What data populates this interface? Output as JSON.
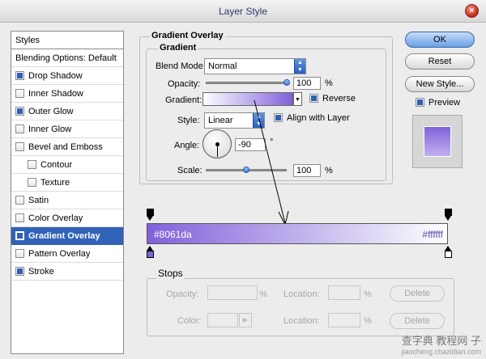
{
  "window": {
    "title": "Layer Style"
  },
  "styles_list": {
    "header": "Styles",
    "blending": "Blending Options: Default",
    "items": [
      {
        "label": "Drop Shadow",
        "checked": true,
        "indent": false,
        "selected": false
      },
      {
        "label": "Inner Shadow",
        "checked": false,
        "indent": false,
        "selected": false
      },
      {
        "label": "Outer Glow",
        "checked": true,
        "indent": false,
        "selected": false
      },
      {
        "label": "Inner Glow",
        "checked": false,
        "indent": false,
        "selected": false
      },
      {
        "label": "Bevel and Emboss",
        "checked": false,
        "indent": false,
        "selected": false
      },
      {
        "label": "Contour",
        "checked": false,
        "indent": true,
        "selected": false
      },
      {
        "label": "Texture",
        "checked": false,
        "indent": true,
        "selected": false
      },
      {
        "label": "Satin",
        "checked": false,
        "indent": false,
        "selected": false
      },
      {
        "label": "Color Overlay",
        "checked": false,
        "indent": false,
        "selected": false
      },
      {
        "label": "Gradient Overlay",
        "checked": true,
        "indent": false,
        "selected": true
      },
      {
        "label": "Pattern Overlay",
        "checked": false,
        "indent": false,
        "selected": false
      },
      {
        "label": "Stroke",
        "checked": true,
        "indent": false,
        "selected": false
      }
    ]
  },
  "gradient_overlay": {
    "section_title": "Gradient Overlay",
    "group_title": "Gradient",
    "blend_mode_label": "Blend Mode:",
    "blend_mode_value": "Normal",
    "opacity_label": "Opacity:",
    "opacity_value": "100",
    "opacity_fraction": 1.0,
    "percent": "%",
    "gradient_label": "Gradient:",
    "reverse_label": "Reverse",
    "reverse_checked": true,
    "style_label": "Style:",
    "style_value": "Linear",
    "align_label": "Align with Layer",
    "align_checked": true,
    "angle_label": "Angle:",
    "angle_value": "-90",
    "degree": "°",
    "scale_label": "Scale:",
    "scale_value": "100",
    "scale_fraction": 0.5
  },
  "buttons": {
    "ok": "OK",
    "reset": "Reset",
    "new_style": "New Style...",
    "preview_label": "Preview",
    "preview_checked": true
  },
  "gradient_editor": {
    "left_color": "#8061da",
    "right_color": "#ffffff",
    "left_label": "#8061da",
    "right_label": "#ffffff"
  },
  "stops": {
    "title": "Stops",
    "opacity_label": "Opacity:",
    "location_label": "Location:",
    "color_label": "Color:",
    "percent": "%",
    "delete_label": "Delete"
  },
  "watermark": {
    "line1": "查字典 教程网 子",
    "line2": "jiaocheng.chazidian.com"
  }
}
